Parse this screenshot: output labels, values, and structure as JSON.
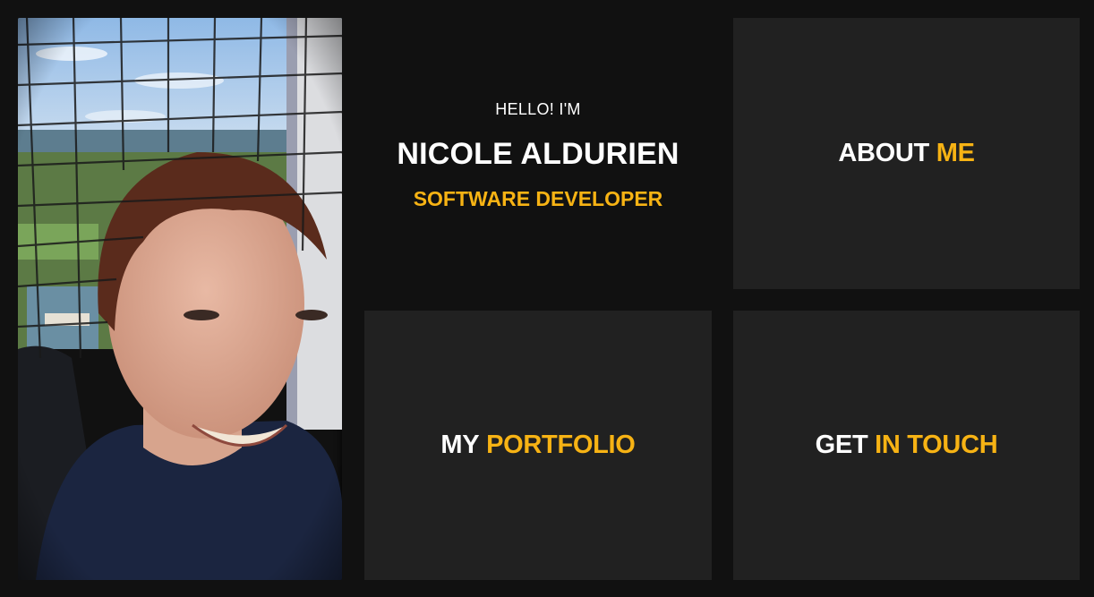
{
  "intro": {
    "greeting": "HELLO! I'M",
    "name": "NICOLE ALDURIEN",
    "role": "SOFTWARE DEVELOPER"
  },
  "tiles": {
    "about": {
      "word1": "ABOUT",
      "word2": "ME"
    },
    "portfolio": {
      "word1": "MY",
      "word2": "PORTFOLIO"
    },
    "contact": {
      "word1": "GET",
      "word2": "IN TOUCH"
    }
  },
  "colors": {
    "accent": "#f7b314",
    "background": "#111111",
    "tile": "#212121",
    "text": "#ffffff"
  }
}
